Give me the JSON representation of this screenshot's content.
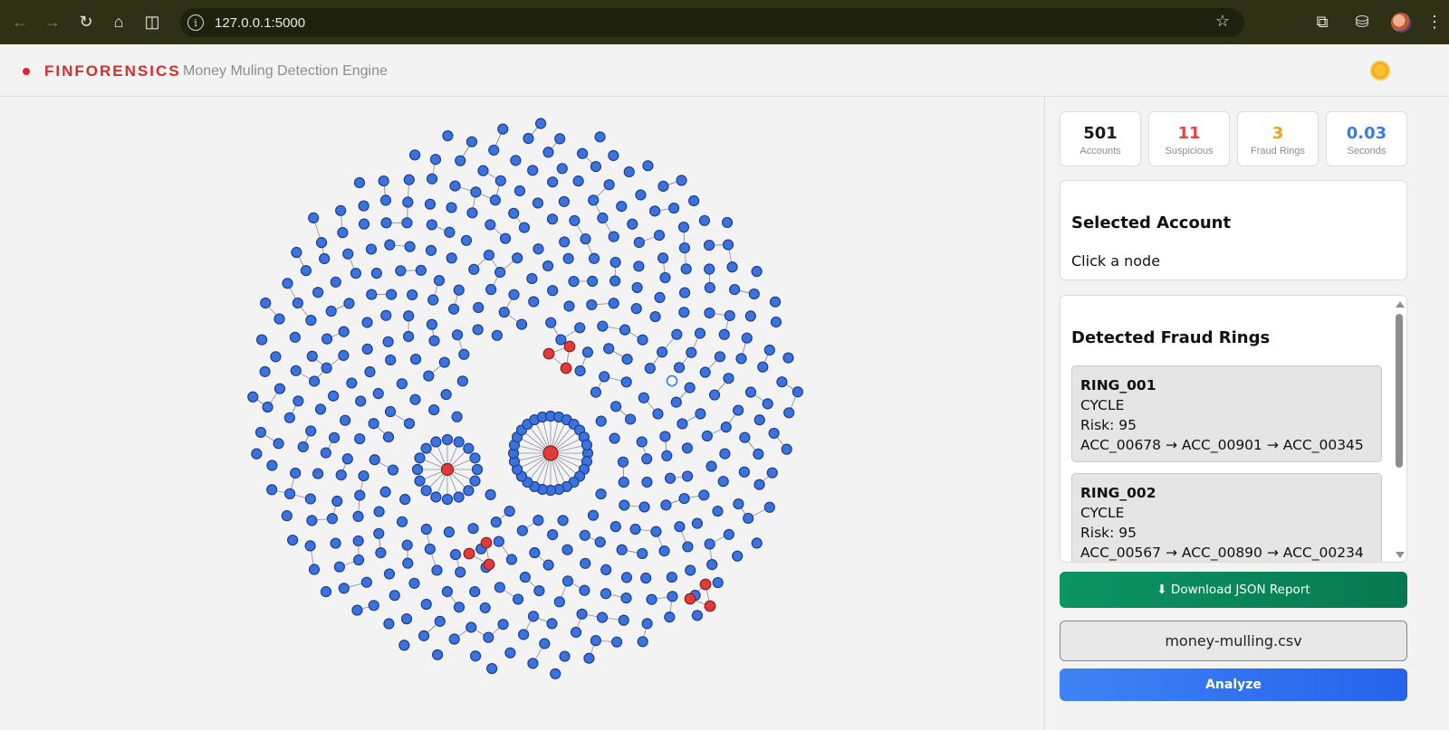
{
  "browser": {
    "url": "127.0.0.1:5000",
    "back_icon": "arrow-left-icon",
    "forward_icon": "arrow-right-icon",
    "reload_icon": "reload-icon",
    "home_icon": "home-icon",
    "split_icon": "split-view-icon",
    "bookmark_icon": "star-icon",
    "extensions_icon": "puzzle-icon",
    "incognito_icon": "incognito-icon",
    "menu_icon": "kebab-menu-icon"
  },
  "header": {
    "brand": "FINFORENSICS",
    "subtitle": "Money Muling Detection Engine",
    "theme_icon": "sun-icon"
  },
  "stats": [
    {
      "value": "501",
      "label": "Accounts",
      "color": "#1a1a1a"
    },
    {
      "value": "11",
      "label": "Suspicious",
      "color": "#e64545"
    },
    {
      "value": "3",
      "label": "Fraud Rings",
      "color": "#f0a21f"
    },
    {
      "value": "0.03",
      "label": "Seconds",
      "color": "#3b7be0"
    }
  ],
  "selected": {
    "title": "Selected Account",
    "hint": "Click a node"
  },
  "rings": {
    "title": "Detected Fraud Rings",
    "items": [
      {
        "id": "RING_001",
        "type": "CYCLE",
        "risk": "Risk: 95",
        "path": "ACC_00678 → ACC_00901 → ACC_00345"
      },
      {
        "id": "RING_002",
        "type": "CYCLE",
        "risk": "Risk: 95",
        "path": "ACC_00567 → ACC_00890 → ACC_00234"
      }
    ]
  },
  "actions": {
    "download": "⬇ Download JSON Report",
    "file": "money-mulling.csv",
    "analyze": "Analyze"
  },
  "graph": {
    "node_color": "#3b72dd",
    "suspicious_color": "#e03a3a",
    "edge_color": "#8a8f99",
    "total_nodes": 501,
    "suspicious_nodes": 11
  }
}
